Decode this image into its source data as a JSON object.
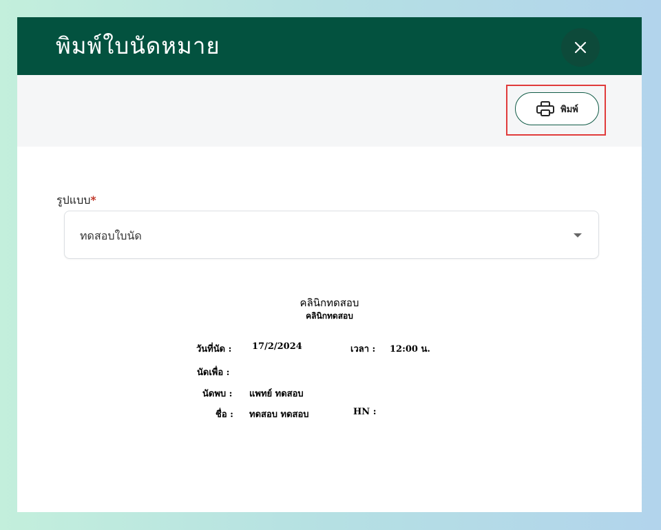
{
  "dialog": {
    "title": "พิมพ์ใบนัดหมาย",
    "close_label": "×"
  },
  "toolbar": {
    "print_label": "พิมพ์",
    "print_icon": "printer-icon"
  },
  "form": {
    "format_label": "รูปแบบ",
    "required_mark": "*",
    "format_value": "ทดสอบใบนัด",
    "dropdown_icon": "caret-down-icon"
  },
  "preview": {
    "clinic_name": "คลินิกทดสอบ",
    "clinic_subtitle": "คลินิกทดสอบ",
    "appointment_date_label": "วันที่นัด :",
    "appointment_date": "17/2/2024",
    "time_label": "เวลา :",
    "time_value": "12:00 น.",
    "purpose_label": "นัดเพื่อ :",
    "doctor_label": "นัดพบ :",
    "doctor_value": "แพทย์ ทดสอบ",
    "name_label": "ชื่อ :",
    "name_value": "ทดสอบ ทดสอบ",
    "hn_label": "HN :"
  },
  "colors": {
    "header_bg": "#03523f",
    "highlight": "#e03a3a",
    "accent": "#0f5a45"
  }
}
